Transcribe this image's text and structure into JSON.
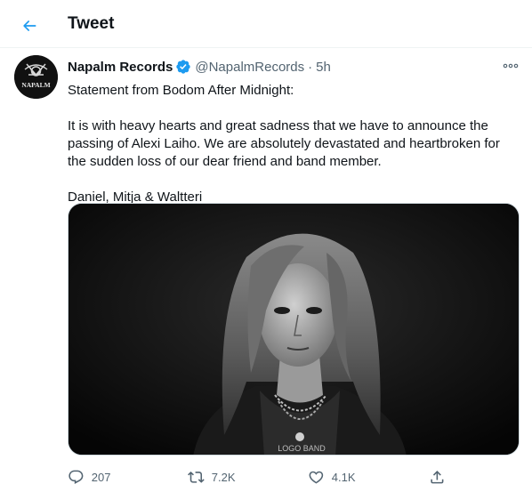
{
  "header": {
    "title": "Tweet",
    "back_icon": "arrow-left-icon"
  },
  "tweet": {
    "author": {
      "name": "Napalm Records",
      "handle": "@NapalmRecords",
      "time": "5h",
      "separator": "·",
      "verified": true,
      "avatar_text": "NAPALM"
    },
    "lines": [
      "Statement from Bodom After Midnight:",
      "It is with heavy hearts and great sadness that we have to announce the passing of Alexi Laiho. We are absolutely devastated and heartbroken for the sudden loss of our dear friend and band member.",
      "Daniel, Mitja & Waltteri"
    ],
    "media": {
      "shirt_text": "LOGO BAND"
    },
    "actions": {
      "reply_count": "207",
      "retweet_count": "7.2K",
      "like_count": "4.1K"
    }
  },
  "colors": {
    "accent": "#1d9bf0",
    "text_primary": "#0f1419",
    "text_secondary": "#536471",
    "divider": "#eff3f4"
  }
}
